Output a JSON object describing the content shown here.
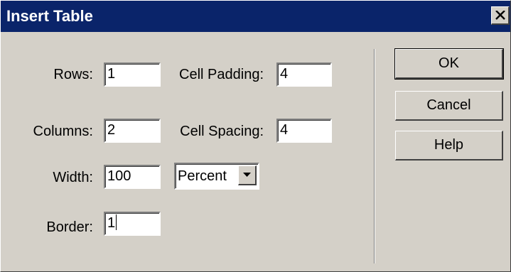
{
  "window": {
    "title": "Insert Table",
    "close_glyph": "close-icon"
  },
  "form": {
    "rows": {
      "label": "Rows:",
      "value": "1"
    },
    "columns": {
      "label": "Columns:",
      "value": "2"
    },
    "width": {
      "label": "Width:",
      "value": "100"
    },
    "border": {
      "label": "Border:",
      "value": "1"
    },
    "cell_padding": {
      "label": "Cell Padding:",
      "value": "4"
    },
    "cell_spacing": {
      "label": "Cell Spacing:",
      "value": "4"
    },
    "width_unit": {
      "selected": "Percent"
    }
  },
  "buttons": {
    "ok": "OK",
    "cancel": "Cancel",
    "help": "Help"
  },
  "colors": {
    "titlebar": "#0a246a",
    "face": "#d4d0c8"
  }
}
